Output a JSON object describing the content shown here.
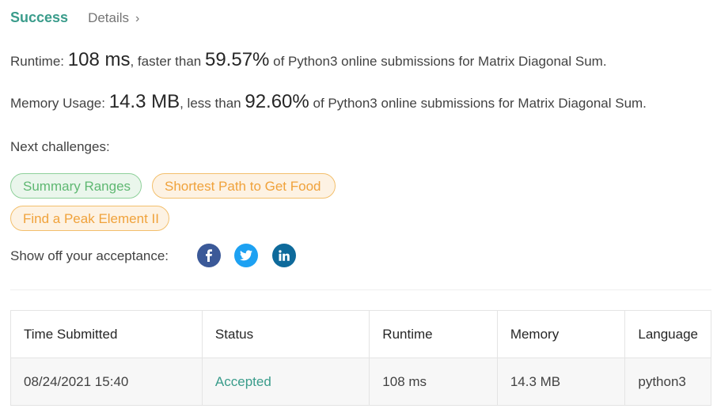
{
  "header": {
    "status": "Success",
    "details_label": "Details",
    "chevron": "›"
  },
  "runtime": {
    "label": "Runtime:",
    "value": "108 ms",
    "mid_text": ", faster than",
    "percent": "59.57%",
    "suffix": "of Python3 online submissions for Matrix Diagonal Sum."
  },
  "memory": {
    "label": "Memory Usage:",
    "value": "14.3 MB",
    "mid_text": ", less than",
    "percent": "92.60%",
    "suffix": "of Python3 online submissions for Matrix Diagonal Sum."
  },
  "next_challenges": {
    "label": "Next challenges:",
    "items": [
      {
        "title": "Summary Ranges",
        "difficulty": "easy",
        "color": "#5fb872"
      },
      {
        "title": "Shortest Path to Get Food",
        "difficulty": "medium",
        "color": "#f0a23b"
      },
      {
        "title": "Find a Peak Element II",
        "difficulty": "medium",
        "color": "#f0a23b"
      }
    ]
  },
  "share": {
    "label": "Show off your acceptance:",
    "icons": [
      "facebook-icon",
      "twitter-icon",
      "linkedin-icon"
    ]
  },
  "table": {
    "headers": [
      "Time Submitted",
      "Status",
      "Runtime",
      "Memory",
      "Language"
    ],
    "rows": [
      [
        "08/24/2021 15:40",
        "Accepted",
        "108 ms",
        "14.3 MB",
        "python3"
      ]
    ]
  },
  "colors": {
    "accent": "#3a9c8b",
    "easy": "#5fb872",
    "medium": "#f0a23b",
    "facebook": "#3b5998",
    "twitter": "#1da1f2",
    "linkedin": "#0e6a9b"
  }
}
